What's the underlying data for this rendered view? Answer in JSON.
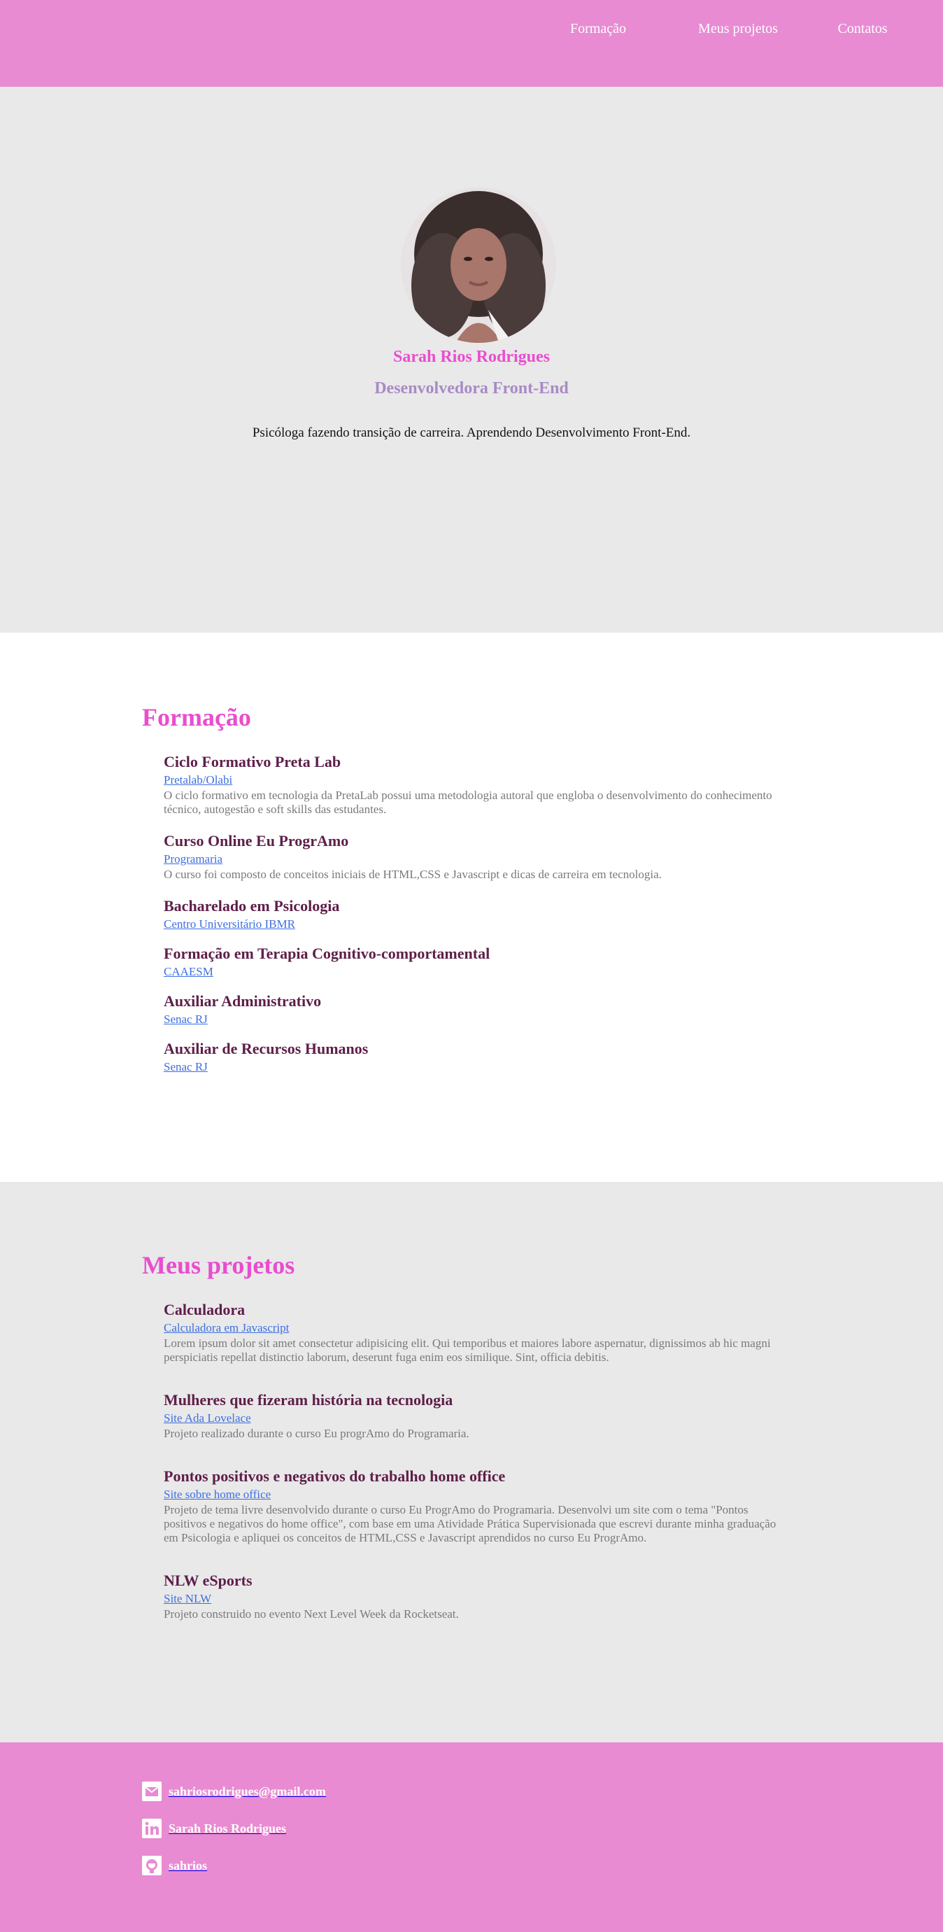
{
  "nav": {
    "items": [
      "Formação",
      "Meus projetos",
      "Contatos"
    ]
  },
  "hero": {
    "name": "Sarah Rios Rodrigues",
    "role": "Desenvolvedora Front-End",
    "bio": "Psicóloga fazendo transição de carreira. Aprendendo Desenvolvimento Front-End."
  },
  "formacao": {
    "title": "Formação",
    "items": [
      {
        "title": "Ciclo Formativo Preta Lab",
        "link": "Pretalab/Olabi",
        "desc": "O ciclo formativo em tecnologia da PretaLab possui uma metodologia autoral que engloba o desenvolvimento do conhecimento técnico, autogestão e soft skills das estudantes."
      },
      {
        "title": "Curso Online Eu ProgrAmo",
        "link": "Programaria",
        "desc": "O curso foi composto de conceitos iniciais de HTML,CSS e Javascript e dicas de carreira em tecnologia."
      },
      {
        "title": "Bacharelado em Psicologia",
        "link": "Centro Universitário IBMR"
      },
      {
        "title": "Formação em Terapia Cognitivo-comportamental",
        "link": "CAAESM"
      },
      {
        "title": "Auxiliar Administrativo",
        "link": "Senac RJ"
      },
      {
        "title": "Auxiliar de Recursos Humanos",
        "link": "Senac RJ"
      }
    ]
  },
  "projetos": {
    "title": "Meus projetos",
    "items": [
      {
        "title": "Calculadora",
        "link": "Calculadora em Javascript",
        "desc": "Lorem ipsum dolor sit amet consectetur adipisicing elit. Qui temporibus et maiores labore aspernatur, dignissimos ab hic magni perspiciatis repellat distinctio laborum, deserunt fuga enim eos similique. Sint, officia debitis."
      },
      {
        "title": "Mulheres que fizeram história na tecnologia",
        "link": "Site Ada Lovelace",
        "desc": "Projeto realizado durante o curso Eu progrAmo do Programaria."
      },
      {
        "title": "Pontos positivos e negativos do trabalho home office",
        "link": "Site sobre home office",
        "desc": "Projeto de tema livre desenvolvido durante o curso Eu ProgrAmo do Programaria. Desenvolvi um site com o tema \"Pontos positivos e negativos do home office\", com base em uma Atividade Prática Supervisionada que escrevi durante minha graduação em Psicologia e apliquei os conceitos de HTML,CSS e Javascript aprendidos no curso Eu ProgrAmo."
      },
      {
        "title": "NLW eSports",
        "link": "Site NLW",
        "desc": "Projeto construido no evento Next Level Week da Rocketseat."
      }
    ]
  },
  "contatos": {
    "email": "sahriosrodrigues@gmail.com",
    "linkedin": "Sarah Rios Rodrigues",
    "github": "sahrios"
  },
  "icons": {
    "email": "envelope-icon",
    "linkedin": "linkedin-icon",
    "github": "github-icon"
  },
  "colors": {
    "header_bg": "#e88bd2",
    "accent": "#e94dcf",
    "role": "#a98ac6",
    "item_title": "#5e1e49",
    "link": "#3d6fe0"
  }
}
